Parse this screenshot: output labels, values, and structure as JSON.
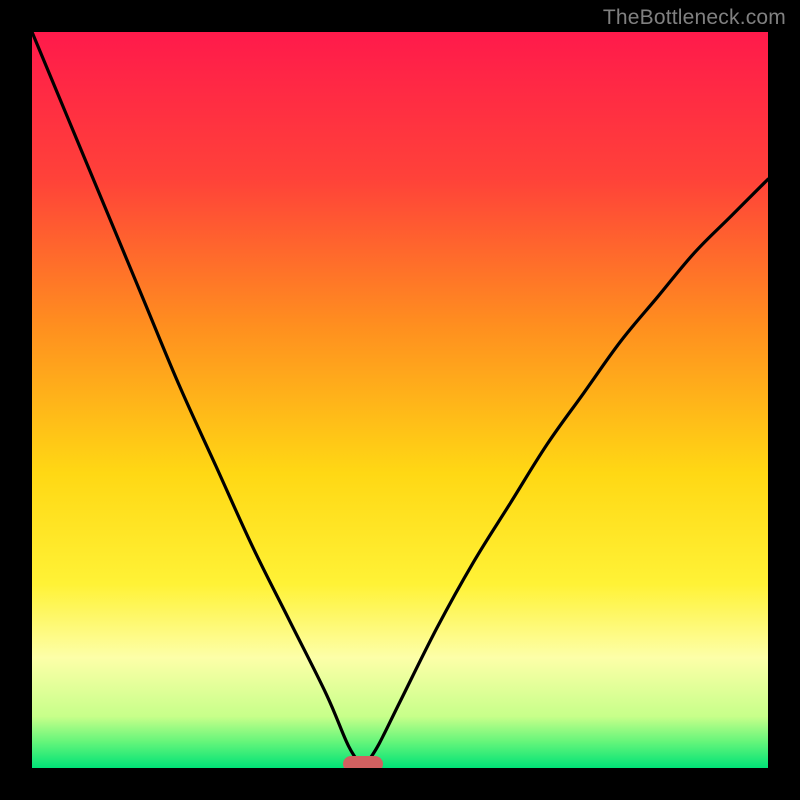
{
  "watermark": "TheBottleneck.com",
  "chart_data": {
    "type": "line",
    "title": "",
    "xlabel": "",
    "ylabel": "",
    "xlim": [
      0,
      100
    ],
    "ylim": [
      0,
      100
    ],
    "grid": false,
    "legend": false,
    "series": [
      {
        "name": "bottleneck-curve",
        "x": [
          0,
          5,
          10,
          15,
          20,
          25,
          30,
          35,
          40,
          43,
          45,
          47,
          50,
          55,
          60,
          65,
          70,
          75,
          80,
          85,
          90,
          95,
          100
        ],
        "values": [
          100,
          88,
          76,
          64,
          52,
          41,
          30,
          20,
          10,
          3,
          0,
          3,
          9,
          19,
          28,
          36,
          44,
          51,
          58,
          64,
          70,
          75,
          80
        ]
      }
    ],
    "optimal_x": 45,
    "gradient_stops": [
      {
        "pos": 0,
        "color": "#ff1a4b"
      },
      {
        "pos": 0.2,
        "color": "#ff4239"
      },
      {
        "pos": 0.4,
        "color": "#ff8f1f"
      },
      {
        "pos": 0.6,
        "color": "#ffd814"
      },
      {
        "pos": 0.75,
        "color": "#fff236"
      },
      {
        "pos": 0.85,
        "color": "#fdffa8"
      },
      {
        "pos": 0.93,
        "color": "#c7ff8a"
      },
      {
        "pos": 0.965,
        "color": "#63f57a"
      },
      {
        "pos": 1.0,
        "color": "#00e277"
      }
    ],
    "marker": {
      "x": 45,
      "width": 5.5,
      "height": 2.2
    }
  }
}
